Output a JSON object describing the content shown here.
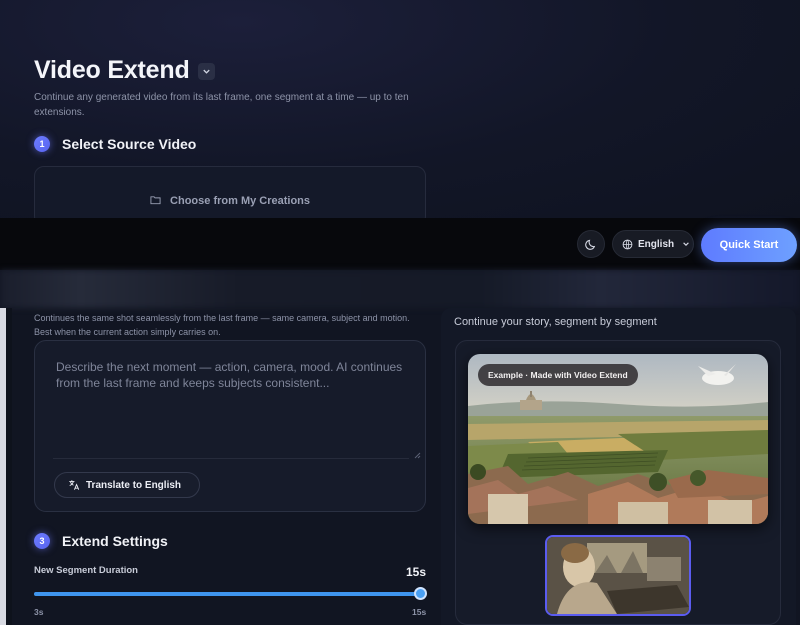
{
  "page": {
    "title": "Video Extend",
    "subtitle": "Continue any generated video from its last frame, one segment at a time — up to ten extensions."
  },
  "steps": [
    {
      "number": "1",
      "title": "Select Source Video"
    },
    {
      "number": "3",
      "title": "Extend Settings"
    }
  ],
  "source": {
    "choose_label": "Choose from My Creations"
  },
  "header": {
    "theme_icon": "moon-icon",
    "language_label": "English",
    "quick_start_label": "Quick Start"
  },
  "prompt": {
    "description": "Continues the same shot seamlessly from the last frame — same camera, subject and motion. Best when the current action simply carries on.",
    "placeholder": "Describe the next moment — action, camera, mood. AI continues from the last frame and keeps subjects consistent...",
    "translate_label": "Translate to English"
  },
  "settings": {
    "duration_label": "New Segment Duration",
    "duration_value": "15s",
    "duration_min_label": "3s",
    "duration_max_label": "15s",
    "duration_min": 3,
    "duration_max": 15,
    "duration_current": 15
  },
  "gallery": {
    "heading": "Continue your story, segment by segment",
    "badge": "Example · Made with Video Extend"
  },
  "colors": {
    "accent": "#5e7bff",
    "slider": "#3f95ee",
    "background": "#111522"
  }
}
